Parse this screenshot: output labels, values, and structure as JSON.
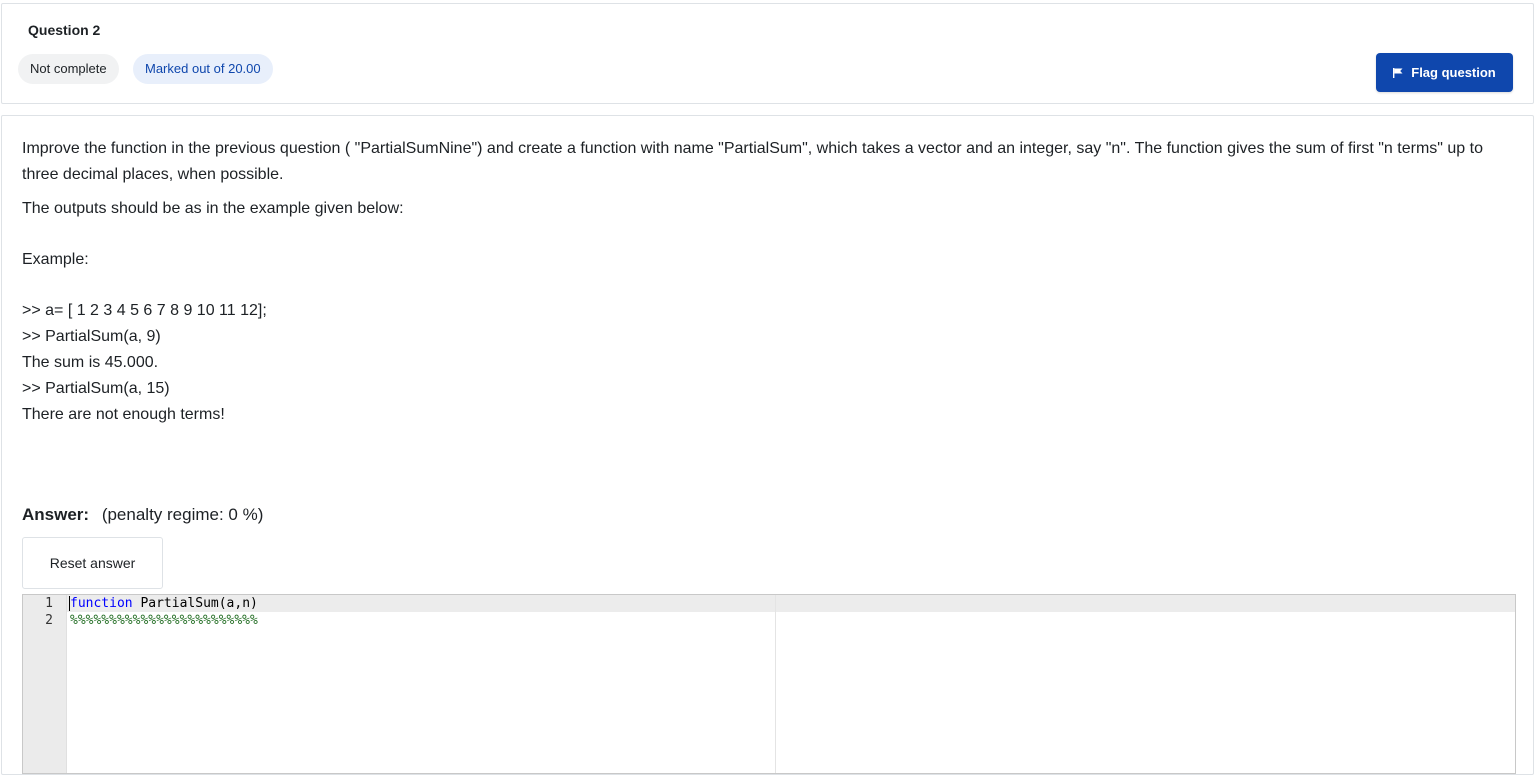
{
  "question": {
    "title": "Question 2",
    "state": "Not complete",
    "grade": "Marked out of 20.00",
    "flag_label": "Flag question"
  },
  "qtext": {
    "line1": "Improve   the function in the previous question ( \"PartialSumNine\") and  create a function with name \"PartialSum\", which takes a vector and an integer, say \"n\". The function gives  the sum of first \"n terms\" up to three decimal places, when possible.",
    "line2": "The outputs should be as in the example given below:",
    "example_label": "Example:",
    "ex1": ">> a= [ 1 2 3 4 5 6 7 8 9 10 11 12];",
    "ex2": ">> PartialSum(a, 9)",
    "ex3": "The sum is 45.000.",
    "ex4": ">> PartialSum(a, 15)",
    "ex5": "There are not enough terms!"
  },
  "answer": {
    "label": "Answer:",
    "penalty": "(penalty regime: 0 %)",
    "reset_label": "Reset answer"
  },
  "editor": {
    "line_numbers": [
      "1",
      "2"
    ],
    "line1_keyword": "function",
    "line1_rest": " PartialSum(a,n)",
    "line2": "%%%%%%%%%%%%%%%%%%%%%%%%"
  },
  "colors": {
    "accent": "#0f47ad",
    "grade_badge_bg": "#e8effb",
    "state_badge_bg": "#f1f2f3",
    "keyword": "#0000ff",
    "comment": "#236e24"
  }
}
